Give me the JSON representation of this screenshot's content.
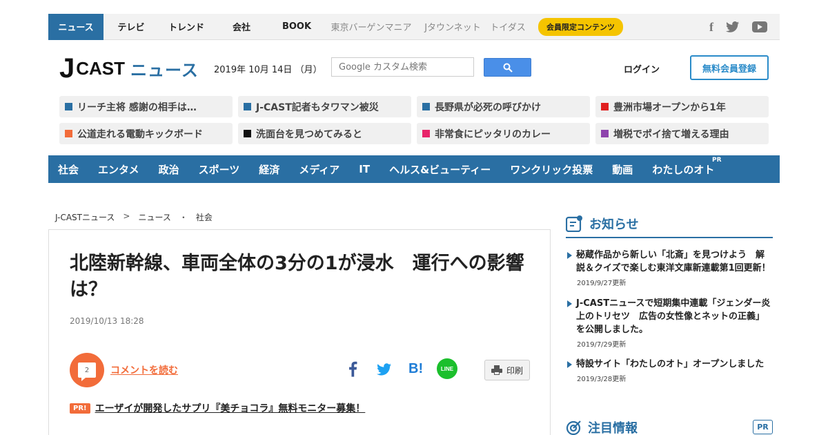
{
  "topnav": {
    "items": [
      "ニュース",
      "テレビ",
      "トレンド",
      "会社",
      "BOOK"
    ],
    "sub_items": [
      "東京バーゲンマニア",
      "Jタウンネット",
      "トイダス"
    ],
    "member_badge": "会員限定コンテンツ",
    "social": [
      "facebook-icon",
      "twitter-icon",
      "youtube-icon"
    ]
  },
  "header": {
    "logo_j": "J",
    "logo_cast": "CAST",
    "logo_news": "ニュース",
    "date": "2019年 10月 14日 （月）",
    "search_placeholder": "Google カスタム検索",
    "login": "ログイン",
    "signup": "無料会員登録"
  },
  "topics": [
    {
      "label": "リーチ主将 感謝の相手は…",
      "color": "#2a6fa3"
    },
    {
      "label": "J-CAST記者もタワマン被災",
      "color": "#2a6fa3"
    },
    {
      "label": "長野県が必死の呼びかけ",
      "color": "#2a6fa3"
    },
    {
      "label": "豊洲市場オープンから1年",
      "color": "#e02020"
    },
    {
      "label": "公道走れる電動キックボード",
      "color": "#f26c3a"
    },
    {
      "label": "洗面台を見つめてみると",
      "color": "#111111"
    },
    {
      "label": "非常食にピッタリのカレー",
      "color": "#e8246a"
    },
    {
      "label": "増税でポイ捨て増える理由",
      "color": "#8e44ad"
    }
  ],
  "categories": [
    "社会",
    "エンタメ",
    "政治",
    "スポーツ",
    "経済",
    "メディア",
    "IT",
    "ヘルス&ビューティー",
    "ワンクリック投票",
    "動画",
    "わたしのオト"
  ],
  "category_pr": "PR",
  "breadcrumb": [
    "J-CASTニュース",
    ">",
    "ニュース",
    "・",
    "社会"
  ],
  "article": {
    "headline": "北陸新幹線、車両全体の3分の1が浸水　運行への影響は？",
    "date": "2019/10/13 18:28",
    "comment_count": "2",
    "comment_link": "コメントを読む",
    "print": "印刷",
    "pr_badge": "PR!",
    "pr_link": "エーザイが開発したサプリ『美チョコラ』無料モニター募集！",
    "share_b": "B!",
    "share_line": "LINE"
  },
  "sidebar": {
    "notice_title": "お知らせ",
    "notices": [
      {
        "text": "秘蔵作品から新しい「北斎」を見つけよう　解説＆クイズで楽しむ東洋文庫新連載第1回更新！",
        "date": "2019/9/27更新"
      },
      {
        "text": "J-CASTニュースで短期集中連載「ジェンダー炎上のトリセツ　広告の女性像とネットの正義」を公開しました。",
        "date": "2019/7/29更新"
      },
      {
        "text": "特設サイト「わたしのオト」オープンしました",
        "date": "2019/3/28更新"
      }
    ],
    "attention_title": "注目情報",
    "attention_pr": "PR"
  }
}
